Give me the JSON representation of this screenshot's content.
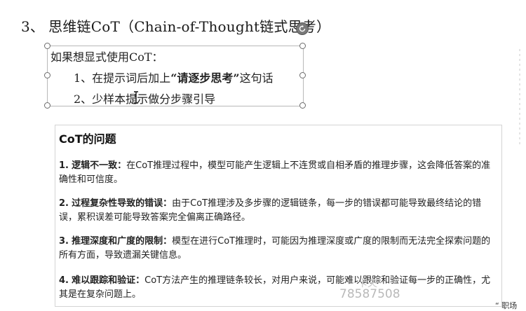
{
  "slide": {
    "title_number": "3、",
    "title_text": "思维链CoT（Chain-of-Thought链式思考）"
  },
  "textbox": {
    "intro": "如果想显式使用CoT：",
    "step1_prefix": "1、在提示词后加上",
    "step1_emph": "“请逐步思考”",
    "step1_suffix": "这句话",
    "step2": "2、少样本提示做分步骤引导"
  },
  "panel": {
    "title": "CoT的问题",
    "issues": [
      {
        "num": "1.",
        "head": "逻辑不一致：",
        "body": "在CoT推理过程中，模型可能产生逻辑上不连贯或自相矛盾的推理步骤，这会降低答案的准确性和可信度。"
      },
      {
        "num": "2.",
        "head": "过程复杂性导致的错误：",
        "body": "由于CoT推理涉及多步骤的逻辑链条，每一步的错误都可能导致最终结论的错误，累积误差可能导致答案完全偏离正确路径。"
      },
      {
        "num": "3.",
        "head": "推理深度和广度的限制：",
        "body": "模型在进行CoT推理时，可能因为推理深度或广度的限制而无法完全探索问题的所有方面，导致遗漏关键信息。"
      },
      {
        "num": "4.",
        "head": "难以跟踪和验证：",
        "body": "CoT方法产生的推理链条较长，对用户来说，可能难以跟踪和验证每一步的正确性，尤其是在复杂问题上。"
      }
    ]
  },
  "watermark": {
    "top": "卡夫",
    "id": "78587508"
  },
  "corner": {
    "text": "“ 职场"
  },
  "colors": {
    "selection_border": "#b8b8b8",
    "handle_border": "#6b6b6b",
    "panel_border": "#d4d4d4",
    "watermark": "#b9b9b9"
  },
  "icons": {
    "rotate_handle": "rotate-icon",
    "text_cursor": "i-beam-cursor-icon"
  }
}
